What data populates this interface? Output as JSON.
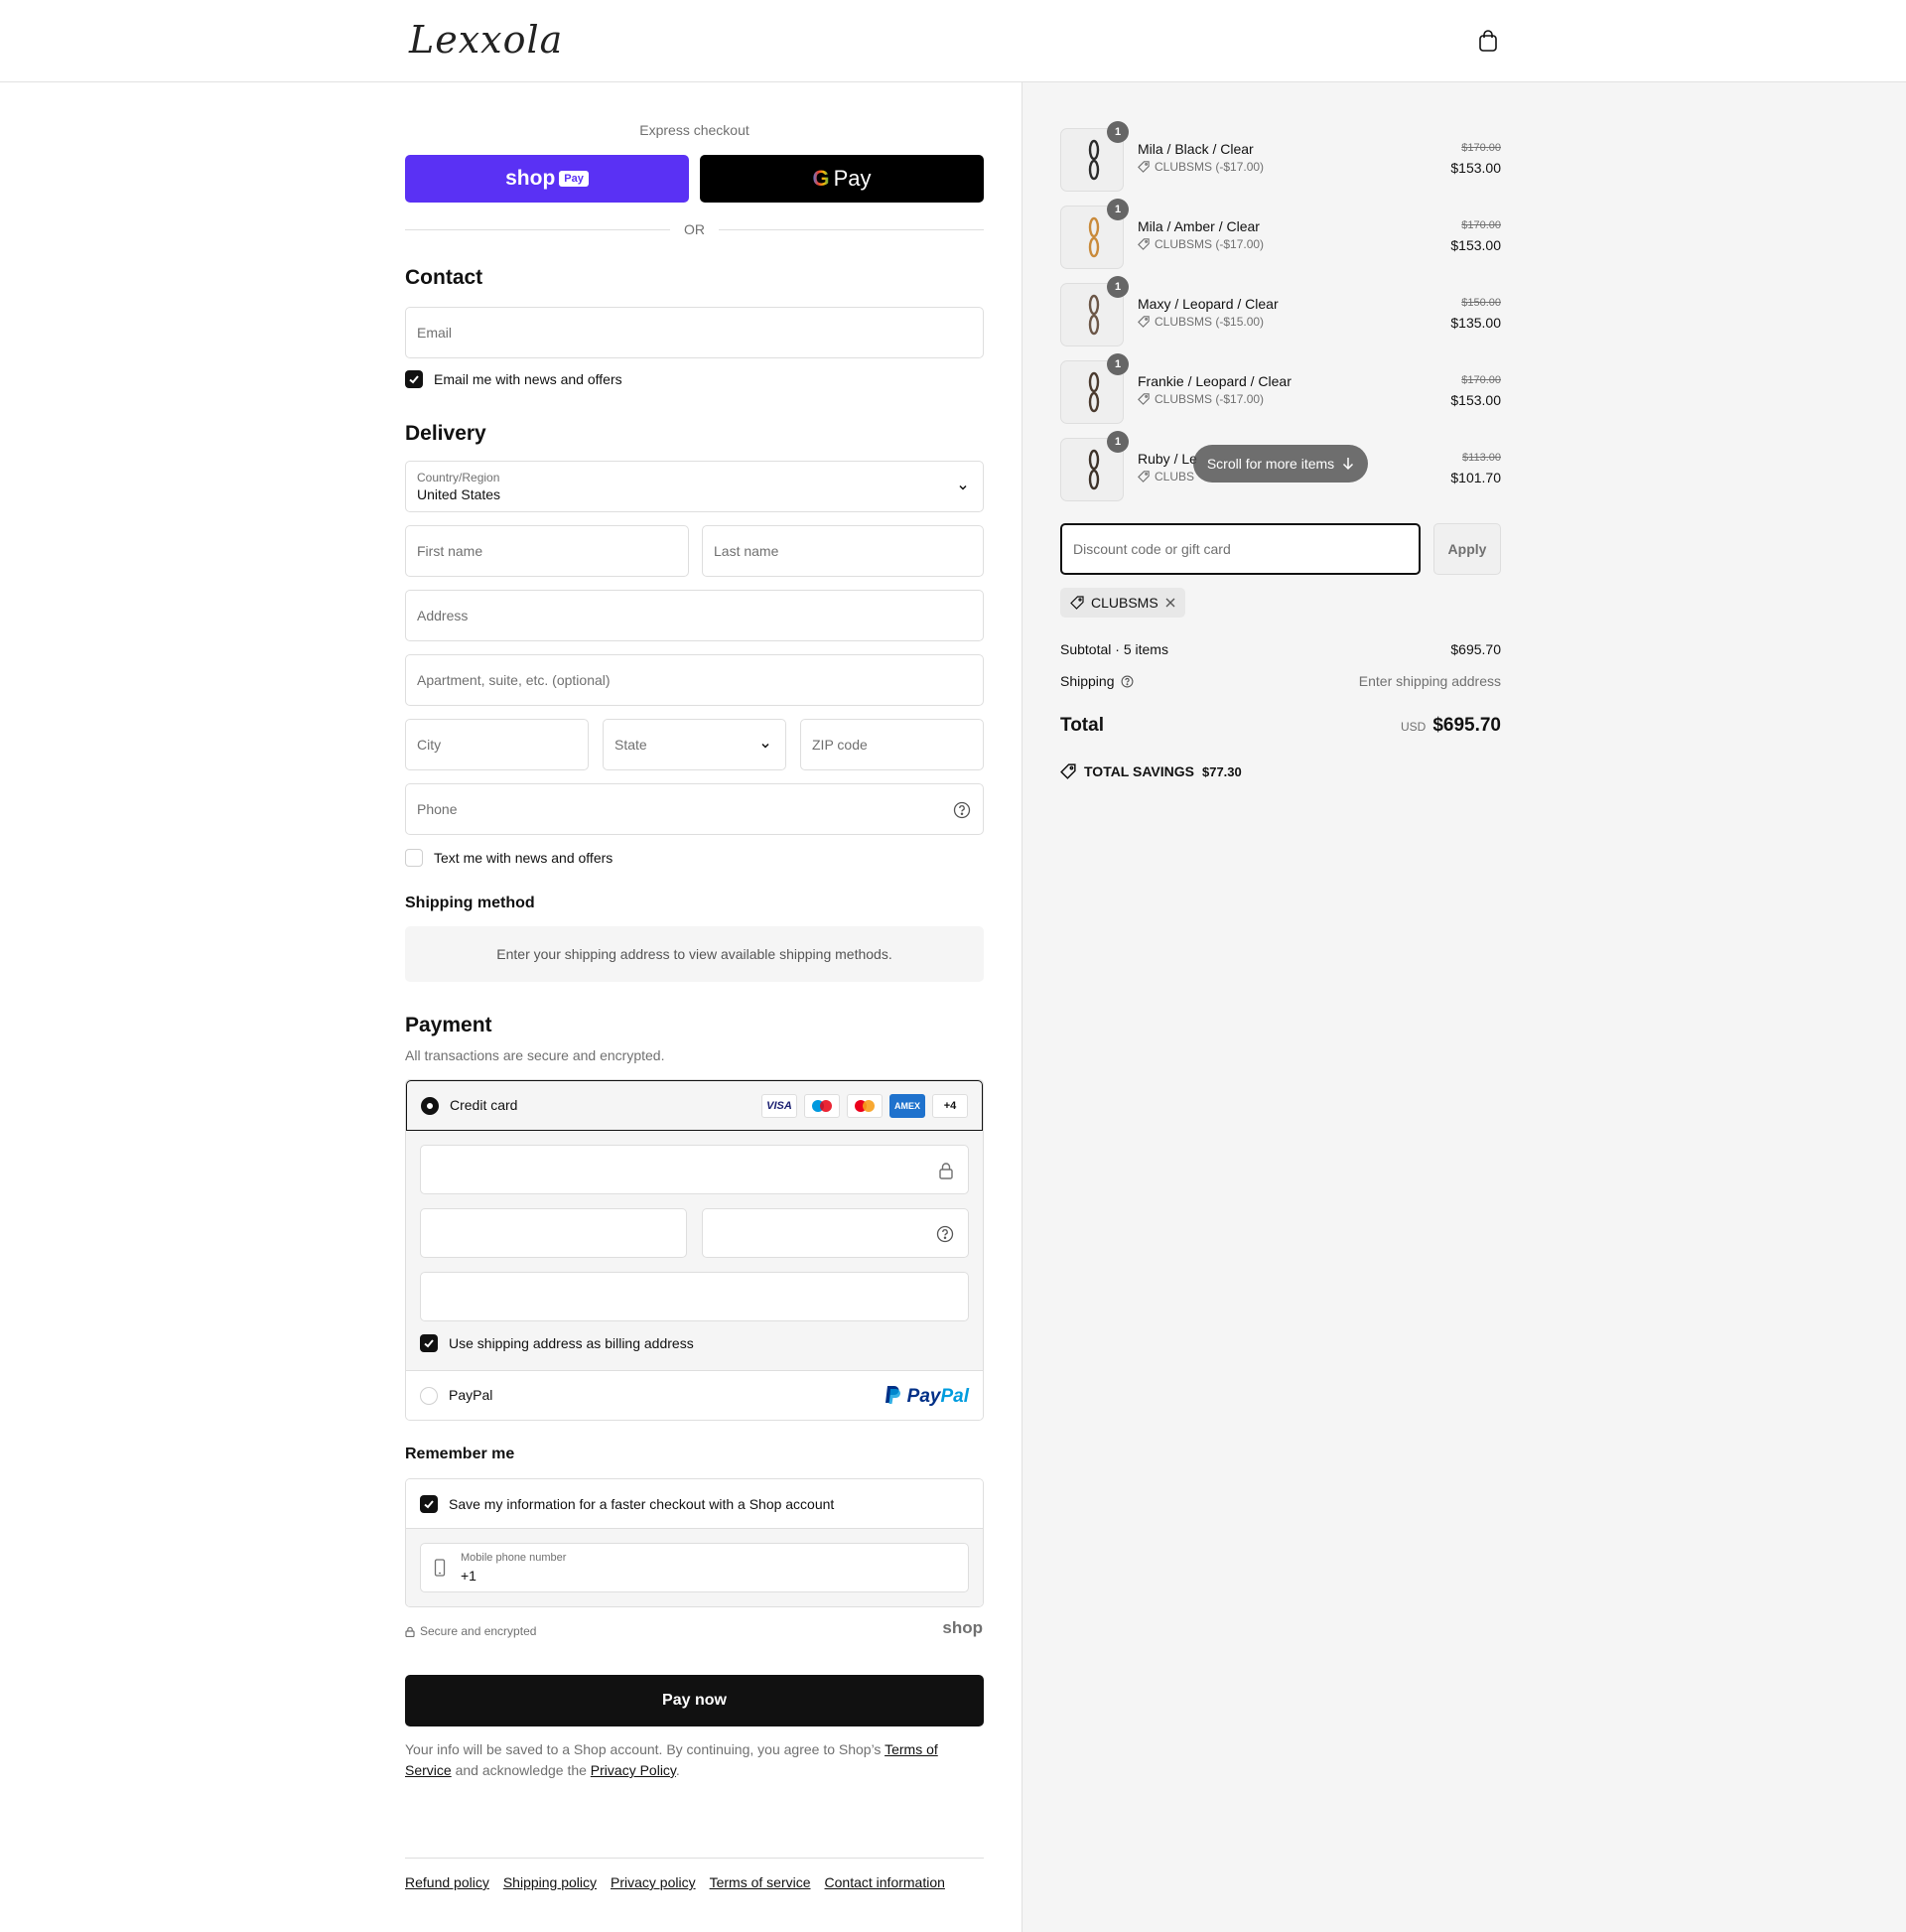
{
  "header": {
    "logo_text": "Lexxola"
  },
  "express": {
    "label": "Express checkout",
    "shop_pay_word": "shop",
    "shop_pay_badge": "Pay",
    "gpay_g": "G",
    "gpay_label": "Pay",
    "or_label": "OR"
  },
  "contact": {
    "heading": "Contact",
    "email_placeholder": "Email",
    "email_optin_label": "Email me with news and offers",
    "email_optin_checked": true
  },
  "delivery": {
    "heading": "Delivery",
    "country_label": "Country/Region",
    "country_value": "United States",
    "first_name_placeholder": "First name",
    "last_name_placeholder": "Last name",
    "address_placeholder": "Address",
    "apartment_placeholder": "Apartment, suite, etc. (optional)",
    "city_placeholder": "City",
    "state_placeholder": "State",
    "zip_placeholder": "ZIP code",
    "phone_placeholder": "Phone",
    "sms_optin_label": "Text me with news and offers",
    "sms_optin_checked": false
  },
  "shipping_method": {
    "heading": "Shipping method",
    "message": "Enter your shipping address to view available shipping methods."
  },
  "payment": {
    "heading": "Payment",
    "subtitle": "All transactions are secure and encrypted.",
    "credit_card_label": "Credit card",
    "card_brands": [
      "VISA",
      "Maestro",
      "Mastercard",
      "AMEX"
    ],
    "more_brands": "+4",
    "billing_same_label": "Use shipping address as billing address",
    "billing_same_checked": true,
    "paypal_label": "PayPal",
    "paypal_logo_a": "Pay",
    "paypal_logo_b": "Pal"
  },
  "remember": {
    "heading": "Remember me",
    "save_label": "Save my information for a faster checkout with a Shop account",
    "save_checked": true,
    "mobile_label": "Mobile phone number",
    "mobile_value": "+1",
    "secure_label": "Secure and encrypted",
    "shop_word": "shop"
  },
  "pay_now": {
    "label": "Pay now"
  },
  "legal": {
    "text_before": "Your info will be saved to a Shop account. By continuing, you agree to Shop’s ",
    "terms_link": "Terms of Service",
    "text_middle": " and acknowledge the ",
    "privacy_link": "Privacy Policy",
    "text_after": "."
  },
  "footer": {
    "links": [
      "Refund policy",
      "Shipping policy",
      "Privacy policy",
      "Terms of service",
      "Contact information"
    ]
  },
  "cart": {
    "items": [
      {
        "name": "Mila / Black / Clear",
        "discount": "CLUBSMS (-$17.00)",
        "old_price": "$170.00",
        "price": "$153.00",
        "qty": "1",
        "frame_color": "#2b2b2b"
      },
      {
        "name": "Mila / Amber / Clear",
        "discount": "CLUBSMS (-$17.00)",
        "old_price": "$170.00",
        "price": "$153.00",
        "qty": "1",
        "frame_color": "#c98a3a"
      },
      {
        "name": "Maxy / Leopard / Clear",
        "discount": "CLUBSMS (-$15.00)",
        "old_price": "$150.00",
        "price": "$135.00",
        "qty": "1",
        "frame_color": "#6b5647"
      },
      {
        "name": "Frankie / Leopard / Clear",
        "discount": "CLUBSMS (-$17.00)",
        "old_price": "$170.00",
        "price": "$153.00",
        "qty": "1",
        "frame_color": "#4a3a2e"
      },
      {
        "name": "Ruby / Le",
        "discount": "CLUBS",
        "old_price": "$113.00",
        "price": "$101.70",
        "qty": "1",
        "frame_color": "#3d3229"
      }
    ],
    "scroll_hint": "Scroll for more items",
    "discount_placeholder": "Discount code or gift card",
    "apply_label": "Apply",
    "applied_code": "CLUBSMS",
    "subtotal_label": "Subtotal · 5 items",
    "subtotal_value": "$695.70",
    "shipping_label": "Shipping",
    "shipping_value": "Enter shipping address",
    "total_label": "Total",
    "total_currency": "USD",
    "total_value": "$695.70",
    "savings_label": "TOTAL SAVINGS",
    "savings_value": "$77.30"
  },
  "colors": {
    "shop_purple": "#5a31f4",
    "primary_dark": "#111111",
    "muted": "#707070",
    "panel_bg": "#f5f5f5"
  }
}
